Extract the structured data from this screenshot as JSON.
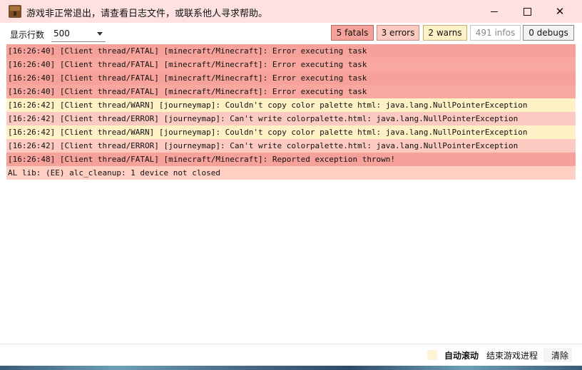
{
  "window": {
    "title": "游戏非正常退出，请查看日志文件，或联系他人寻求帮助。",
    "icon": "minecraft-block-icon"
  },
  "toolbar": {
    "rows_label": "显示行数",
    "rows_value": "500",
    "filters": {
      "fatals": "5 fatals",
      "errors": "3 errors",
      "warns": "2 warns",
      "infos": "491 infos",
      "debugs": "0 debugs"
    }
  },
  "log": {
    "lines": [
      {
        "level": "fatal",
        "text": "[16:26:40] [Client thread/FATAL] [minecraft/Minecraft]: Error executing task"
      },
      {
        "level": "fatal",
        "text": "[16:26:40] [Client thread/FATAL] [minecraft/Minecraft]: Error executing task"
      },
      {
        "level": "fatal",
        "text": "[16:26:40] [Client thread/FATAL] [minecraft/Minecraft]: Error executing task"
      },
      {
        "level": "fatal",
        "text": "[16:26:40] [Client thread/FATAL] [minecraft/Minecraft]: Error executing task"
      },
      {
        "level": "warn",
        "text": "[16:26:42] [Client thread/WARN] [journeymap]: Couldn't copy color palette html: java.lang.NullPointerException"
      },
      {
        "level": "error",
        "text": "[16:26:42] [Client thread/ERROR] [journeymap]: Can't write colorpalette.html: java.lang.NullPointerException"
      },
      {
        "level": "warn",
        "text": "[16:26:42] [Client thread/WARN] [journeymap]: Couldn't copy color palette html: java.lang.NullPointerException"
      },
      {
        "level": "error",
        "text": "[16:26:42] [Client thread/ERROR] [journeymap]: Can't write colorpalette.html: java.lang.NullPointerException"
      },
      {
        "level": "fatal",
        "text": "[16:26:48] [Client thread/FATAL] [minecraft/Minecraft]: Reported exception thrown!"
      },
      {
        "level": "plain",
        "text": "AL lib: (EE) alc_cleanup: 1 device not closed"
      }
    ]
  },
  "statusbar": {
    "autoscroll": "自动滚动",
    "end_process": "结束游戏进程",
    "clear": "清除"
  },
  "colors": {
    "title_bg": "#ffe1e1",
    "fatal": "#f6a29a",
    "error": "#fccac0",
    "warn": "#fff1c6",
    "plain": "#ffcfc3"
  }
}
